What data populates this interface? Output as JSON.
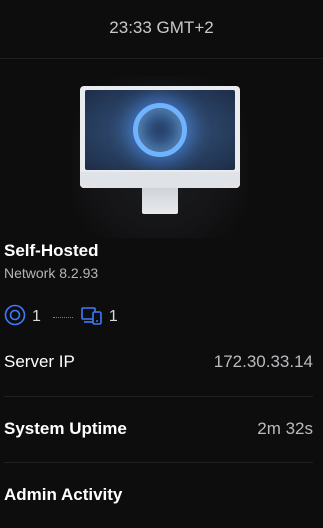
{
  "header": {
    "time": "23:33 GMT+2"
  },
  "device": {
    "name": "Self-Hosted",
    "version": "Network 8.2.93",
    "image_icon": "imac-icon"
  },
  "topology": {
    "accesspoint_icon": "access-point-icon",
    "accesspoint_count": "1",
    "client_icon": "devices-icon",
    "client_count": "1",
    "accent_color": "#3f7bff"
  },
  "details": {
    "server_ip_label": "Server IP",
    "server_ip_value": "172.30.33.14",
    "uptime_label": "System Uptime",
    "uptime_value": "2m 32s",
    "admin_activity_label": "Admin Activity"
  }
}
